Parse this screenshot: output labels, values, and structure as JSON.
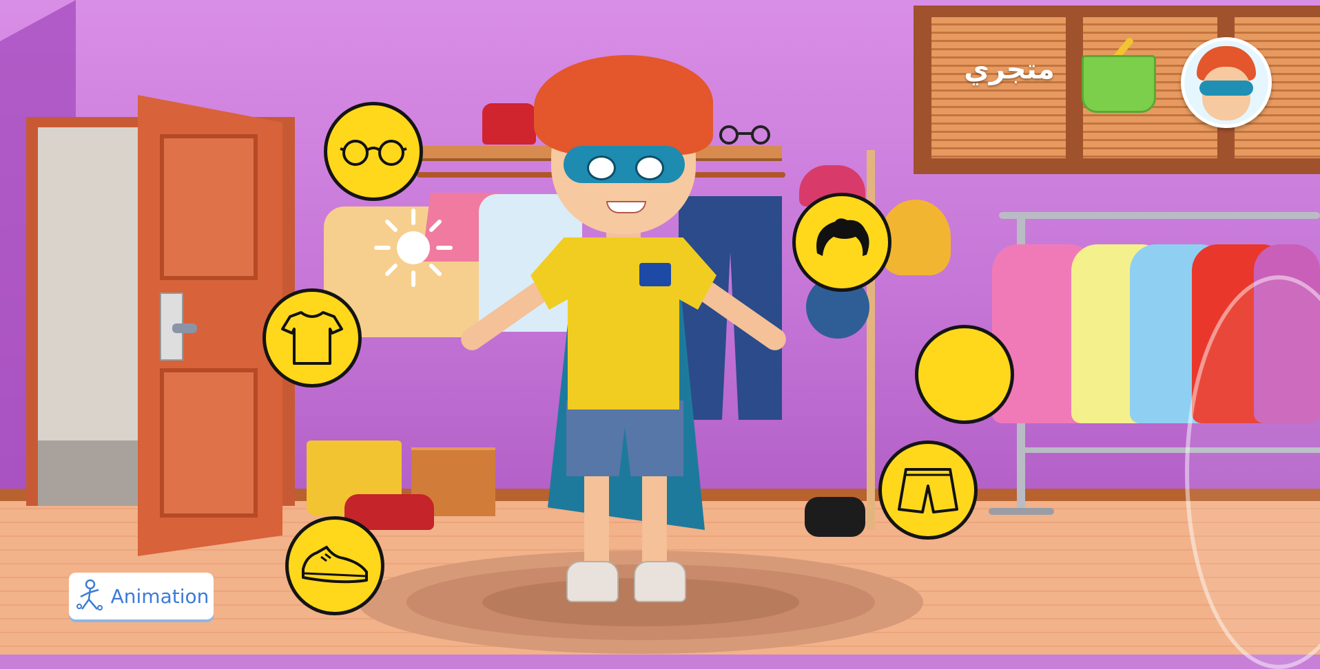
{
  "store": {
    "title": "متجري",
    "basket_icon": "shopping-basket-icon",
    "profile_icon": "boy-avatar-icon"
  },
  "categories": [
    {
      "name": "glasses",
      "icon": "glasses-icon"
    },
    {
      "name": "shirt",
      "icon": "tshirt-icon"
    },
    {
      "name": "shoes",
      "icon": "sneaker-icon"
    },
    {
      "name": "hair",
      "icon": "hair-icon"
    },
    {
      "name": "blank",
      "icon": ""
    },
    {
      "name": "shorts",
      "icon": "shorts-icon"
    }
  ],
  "animation_button": {
    "label": "Animation",
    "icon": "stick-figure-icon"
  },
  "colors": {
    "button_fill": "#ffd81c",
    "button_border": "#141414",
    "accent_blue": "#3c7bd6",
    "wall": "#c77fd8"
  }
}
